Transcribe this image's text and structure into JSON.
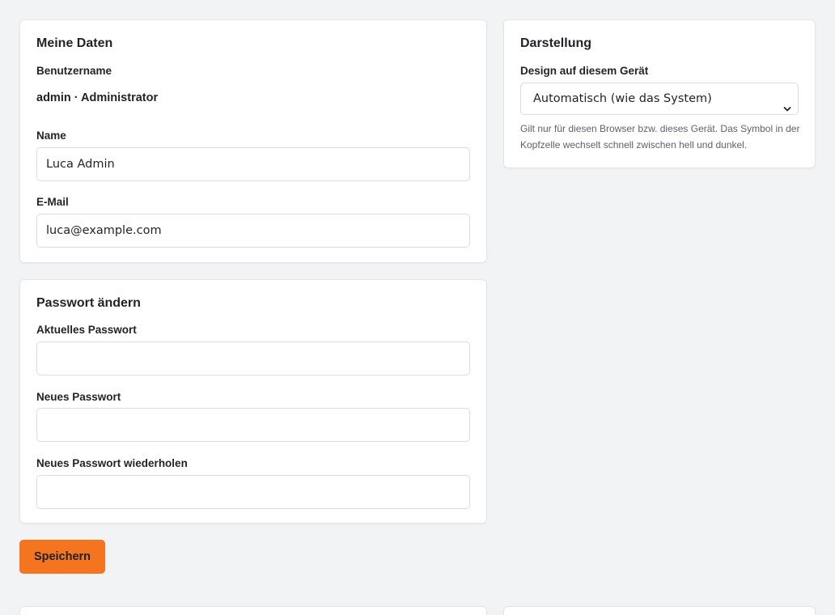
{
  "profile": {
    "title": "Meine Daten",
    "username_label": "Benutzername",
    "username_value": "admin · Administrator",
    "name_label": "Name",
    "name_value": "Luca Admin",
    "email_label": "E-Mail",
    "email_value": "luca@example.com"
  },
  "password": {
    "title": "Passwort ändern",
    "current_label": "Aktuelles Passwort",
    "current_value": "",
    "new_label": "Neues Passwort",
    "new_value": "",
    "repeat_label": "Neues Passwort wiederholen",
    "repeat_value": ""
  },
  "appearance": {
    "title": "Darstellung",
    "design_label": "Design auf diesem Gerät",
    "design_selected": "Automatisch (wie das System)",
    "help_text": "Gilt nur für diesen Browser bzw. dieses Gerät. Das Symbol in der Kopfzelle wechselt schnell zwischen hell und dunkel."
  },
  "actions": {
    "save_label": "Speichern"
  },
  "colors": {
    "accent": "#f47420",
    "background": "#f2f3f5",
    "card": "#ffffff"
  },
  "icons": {
    "select_chevron": "chevron-down-icon"
  }
}
